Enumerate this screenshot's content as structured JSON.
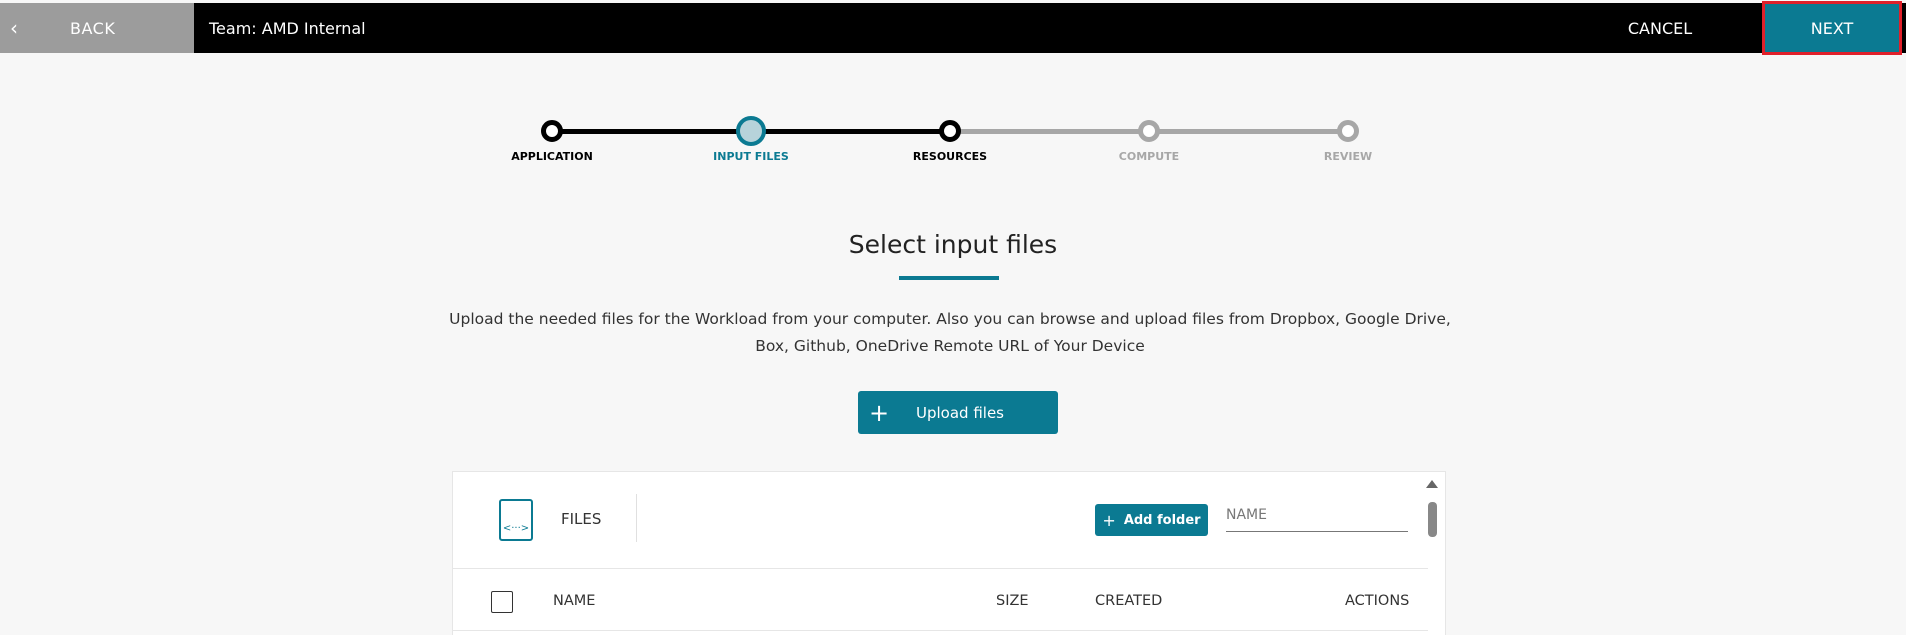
{
  "topbar": {
    "back_label": "BACK",
    "back_icon": "chevron-left-icon",
    "team": "Team: AMD Internal",
    "cancel_label": "CANCEL",
    "next_label": "NEXT"
  },
  "stepper": {
    "steps": [
      {
        "label": "APPLICATION",
        "state": "done"
      },
      {
        "label": "INPUT FILES",
        "state": "active"
      },
      {
        "label": "RESOURCES",
        "state": "done"
      },
      {
        "label": "COMPUTE",
        "state": "todo"
      },
      {
        "label": "REVIEW",
        "state": "todo"
      }
    ]
  },
  "main": {
    "title": "Select input files",
    "description": "Upload the needed files for the Workload from your computer. Also you can browse and upload files from Dropbox, Google Drive, Box, Github, OneDrive Remote URL of Your Device",
    "upload_label": "Upload files",
    "upload_icon": "plus-icon"
  },
  "files_panel": {
    "title": "FILES",
    "icon": "code-file-icon",
    "add_folder_label": "Add folder",
    "name_placeholder": "NAME",
    "columns": {
      "name": "NAME",
      "size": "SIZE",
      "created": "CREATED",
      "actions": "ACTIONS"
    }
  },
  "colors": {
    "accent": "#0b7a92",
    "topbar": "#000000",
    "back": "#9c9c9c",
    "highlight": "#e0202a"
  }
}
